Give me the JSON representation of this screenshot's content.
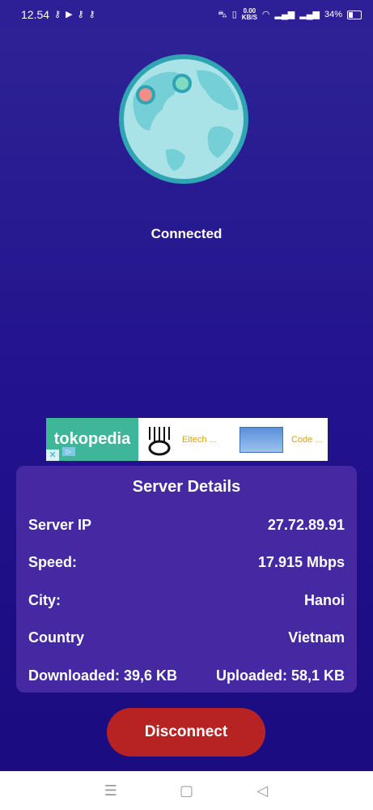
{
  "status_bar": {
    "time": "12.54",
    "net_speed_value": "0.00",
    "net_speed_unit": "KB/S",
    "battery": "34%"
  },
  "connection": {
    "status": "Connected"
  },
  "ad": {
    "brand": "tokopedia",
    "item1": "Eitech ...",
    "item2": "Code ..."
  },
  "server_details": {
    "title": "Server Details",
    "rows": [
      {
        "label": "Server IP",
        "value": "27.72.89.91"
      },
      {
        "label": "Speed:",
        "value": "17.915 Mbps"
      },
      {
        "label": "City:",
        "value": "Hanoi"
      },
      {
        "label": "Country",
        "value": "Vietnam"
      }
    ],
    "downloaded": "Downloaded: 39,6 KB",
    "uploaded": "Uploaded: 58,1 KB"
  },
  "disconnect_label": "Disconnect",
  "colors": {
    "background": "#22128c",
    "card": "#4429a2",
    "disconnect": "#b72222",
    "globe": "#a9e3e8"
  }
}
